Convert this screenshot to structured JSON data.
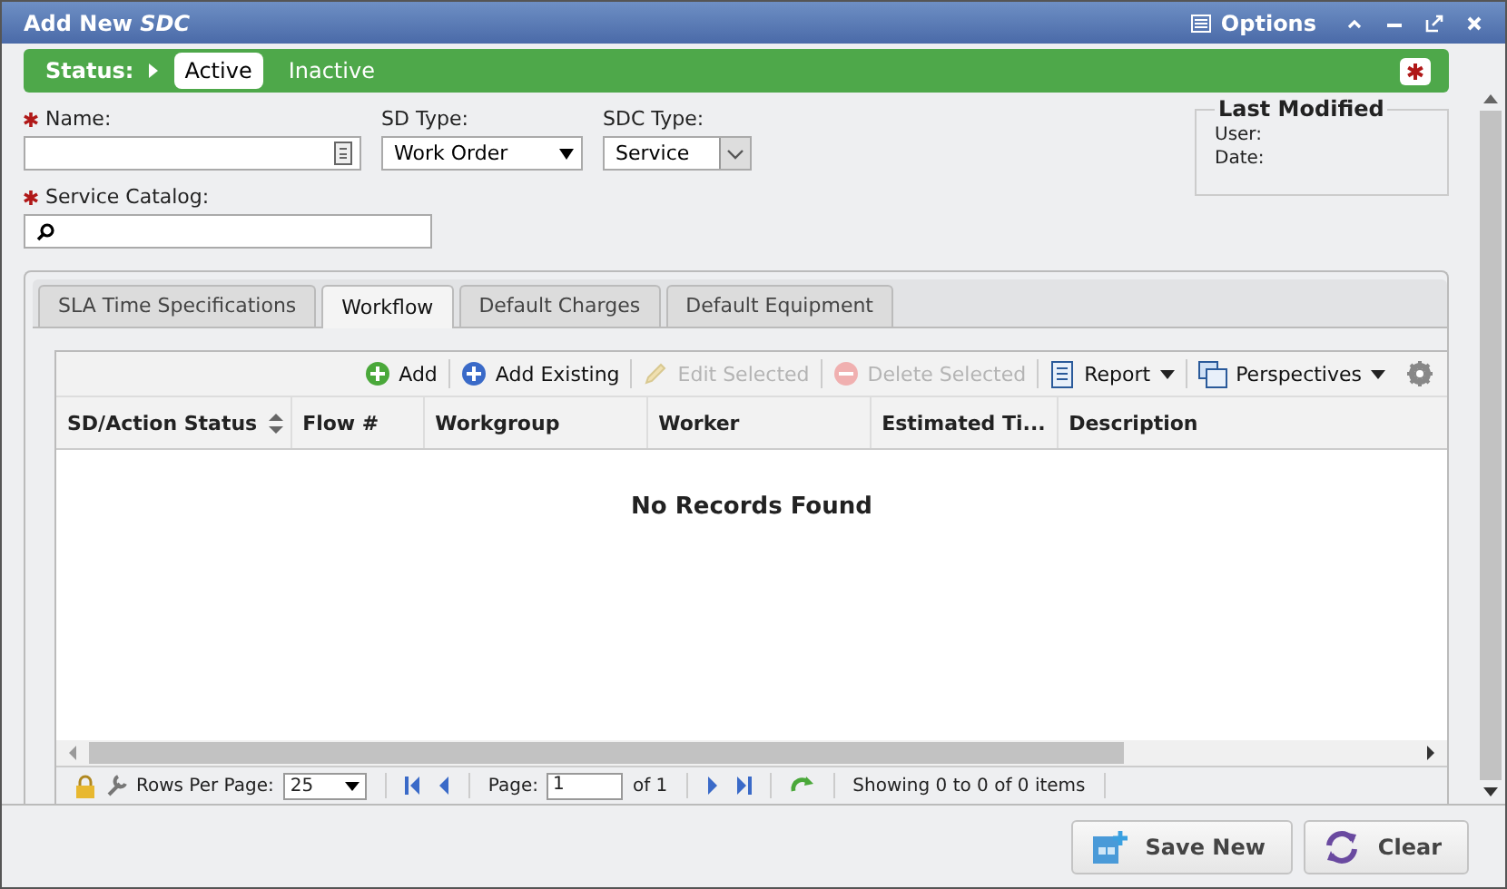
{
  "window": {
    "title": "Add New *SDC*",
    "options_label": "Options"
  },
  "status": {
    "label": "Status:",
    "options": [
      {
        "label": "Active",
        "selected": true
      },
      {
        "label": "Inactive",
        "selected": false
      }
    ]
  },
  "fields": {
    "name": {
      "label": "Name:",
      "required": true
    },
    "sd_type": {
      "label": "SD Type:",
      "value": "Work Order"
    },
    "sdc_type": {
      "label": "SDC Type:",
      "value": "Service"
    },
    "service_catalog": {
      "label": "Service Catalog:",
      "required": true
    }
  },
  "last_modified": {
    "title": "Last Modified",
    "user_label": "User:",
    "date_label": "Date:"
  },
  "tabs": [
    {
      "label": "SLA Time Specifications",
      "selected": false
    },
    {
      "label": "Workflow",
      "selected": true
    },
    {
      "label": "Default Charges",
      "selected": false
    },
    {
      "label": "Default Equipment",
      "selected": false
    }
  ],
  "toolbar": [
    {
      "kind": "add",
      "label": "Add",
      "disabled": false
    },
    {
      "kind": "add-existing",
      "label": "Add Existing",
      "disabled": false
    },
    {
      "kind": "edit",
      "label": "Edit Selected",
      "disabled": true
    },
    {
      "kind": "delete",
      "label": "Delete Selected",
      "disabled": true
    },
    {
      "kind": "report",
      "label": "Report",
      "disabled": false
    },
    {
      "kind": "perspectives",
      "label": "Perspectives",
      "disabled": false
    }
  ],
  "table": {
    "columns": [
      {
        "label": "SD/Action Status",
        "sortable": true
      },
      {
        "label": "Flow #",
        "sortable": false
      },
      {
        "label": "Workgroup",
        "sortable": false
      },
      {
        "label": "Worker",
        "sortable": false
      },
      {
        "label": "Estimated Ti...",
        "sortable": false
      },
      {
        "label": "Description",
        "sortable": false
      }
    ],
    "empty_message": "No Records Found"
  },
  "pager": {
    "rows_label": "Rows Per Page:",
    "rows_value": "25",
    "page_label": "Page:",
    "page_value": "1",
    "of_label": "of 1",
    "summary": "Showing 0 to 0 of 0 items"
  },
  "buttons": [
    {
      "kind": "save",
      "label": "Save New"
    },
    {
      "kind": "clear",
      "label": "Clear"
    }
  ]
}
